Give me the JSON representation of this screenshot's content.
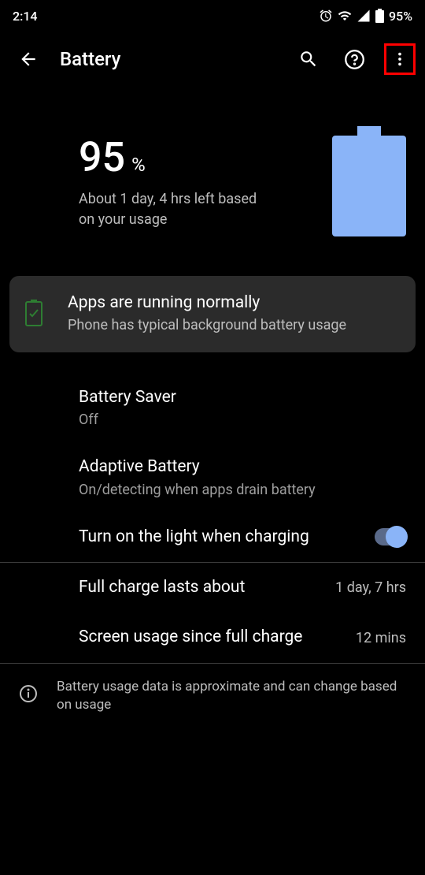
{
  "status_bar": {
    "time": "2:14",
    "battery_pct": "95%"
  },
  "app_bar": {
    "title": "Battery"
  },
  "summary": {
    "pct_number": "95",
    "pct_symbol": "%",
    "estimate": "About 1 day, 4 hrs left based on your usage"
  },
  "card": {
    "title": "Apps are running normally",
    "subtitle": "Phone has typical background battery usage"
  },
  "items": {
    "saver": {
      "title": "Battery Saver",
      "sub": "Off"
    },
    "adaptive": {
      "title": "Adaptive Battery",
      "sub": "On/detecting when apps drain battery"
    },
    "light": {
      "title": "Turn on the light when charging"
    },
    "fullcharge": {
      "title": "Full charge lasts about",
      "value": "1 day, 7 hrs"
    },
    "screenusage": {
      "title": "Screen usage since full charge",
      "value": "12 mins"
    }
  },
  "footer": {
    "text": "Battery usage data is approximate and can change based on usage"
  }
}
